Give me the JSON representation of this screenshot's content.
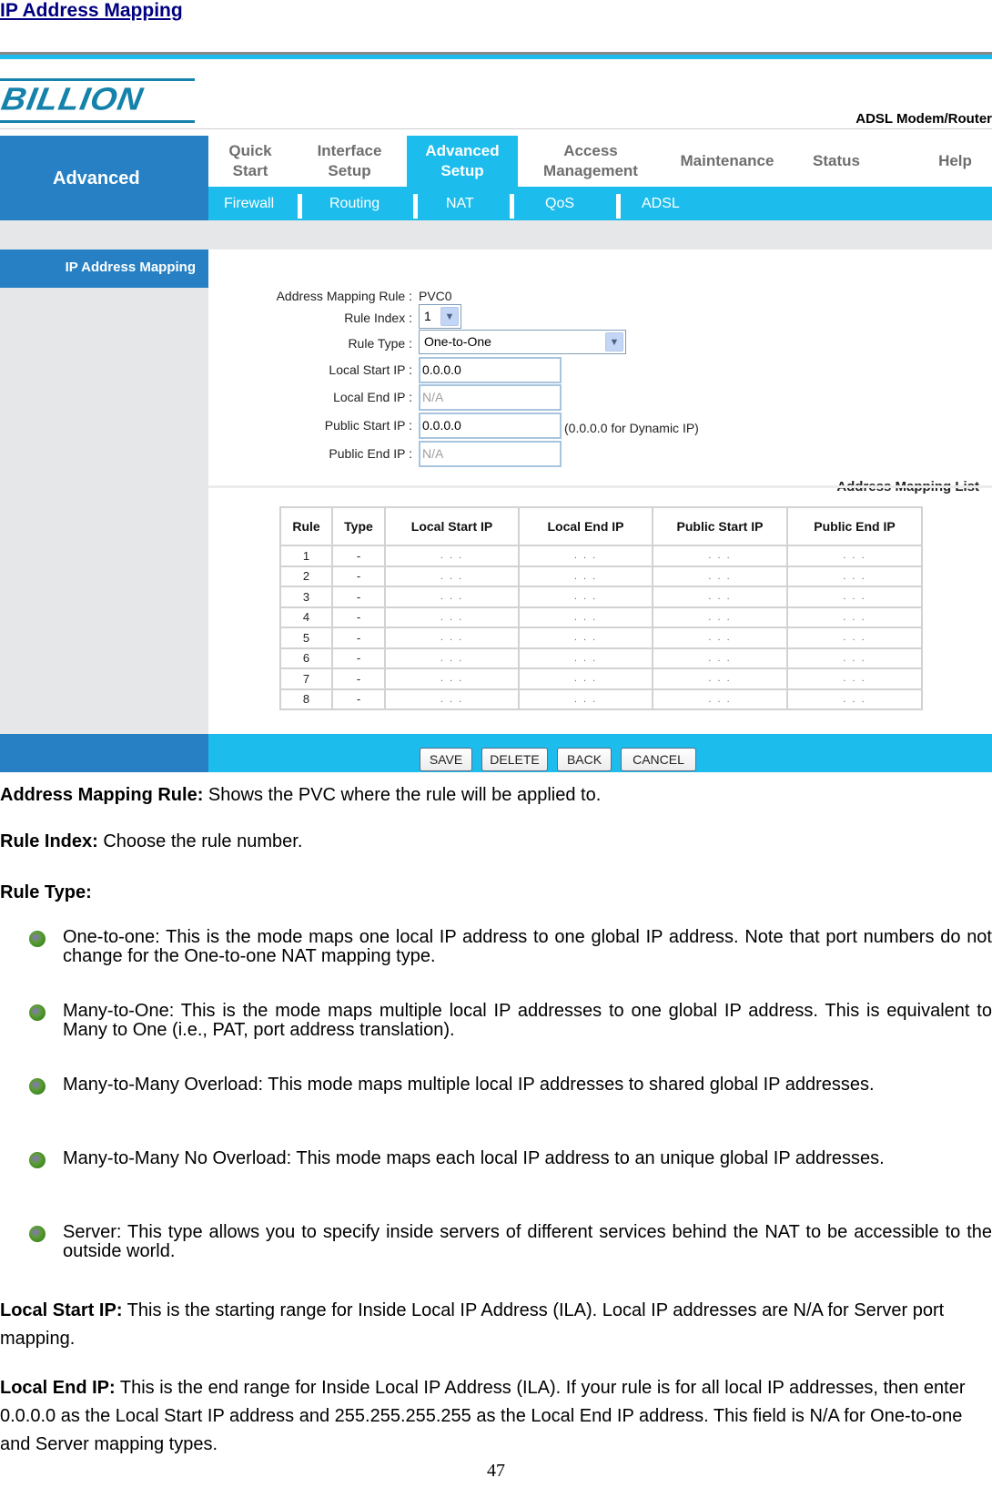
{
  "page_heading": "IP Address Mapping",
  "brand": {
    "logo_text": "BILLION",
    "product": "ADSL Modem/Router"
  },
  "nav": {
    "section": "Advanced",
    "tabs": [
      {
        "label": "Quick\nStart",
        "active": false
      },
      {
        "label": "Interface\nSetup",
        "active": false
      },
      {
        "label": "Advanced\nSetup",
        "active": true
      },
      {
        "label": "Access\nManagement",
        "active": false
      },
      {
        "label": "Maintenance",
        "active": false
      },
      {
        "label": "Status",
        "active": false
      },
      {
        "label": "Help",
        "active": false
      }
    ],
    "subtabs": [
      "Firewall",
      "Routing",
      "NAT",
      "QoS",
      "ADSL"
    ]
  },
  "sidebar": {
    "active": "IP Address Mapping",
    "list_label": "Address Mapping List"
  },
  "form": {
    "address_mapping_rule": {
      "label": "Address Mapping Rule :",
      "value": "PVC0"
    },
    "rule_index": {
      "label": "Rule Index :",
      "value": "1"
    },
    "rule_type": {
      "label": "Rule Type :",
      "value": "One-to-One"
    },
    "local_start_ip": {
      "label": "Local Start IP :",
      "value": "0.0.0.0"
    },
    "local_end_ip": {
      "label": "Local End IP :",
      "value": "N/A"
    },
    "public_start_ip": {
      "label": "Public Start IP :",
      "value": "0.0.0.0",
      "note": "(0.0.0.0 for Dynamic IP)"
    },
    "public_end_ip": {
      "label": "Public End IP :",
      "value": "N/A"
    }
  },
  "mapping_list": {
    "headers": [
      "Rule",
      "Type",
      "Local Start IP",
      "Local End IP",
      "Public Start IP",
      "Public End IP"
    ],
    "rows": [
      [
        "1",
        "-",
        ". . .",
        ". . .",
        ". . .",
        ". . ."
      ],
      [
        "2",
        "-",
        ". . .",
        ". . .",
        ". . .",
        ". . ."
      ],
      [
        "3",
        "-",
        ". . .",
        ". . .",
        ". . .",
        ". . ."
      ],
      [
        "4",
        "-",
        ". . .",
        ". . .",
        ". . .",
        ". . ."
      ],
      [
        "5",
        "-",
        ". . .",
        ". . .",
        ". . .",
        ". . ."
      ],
      [
        "6",
        "-",
        ". . .",
        ". . .",
        ". . .",
        ". . ."
      ],
      [
        "7",
        "-",
        ". . .",
        ". . .",
        ". . .",
        ". . ."
      ],
      [
        "8",
        "-",
        ". . .",
        ". . .",
        ". . .",
        ". . ."
      ]
    ]
  },
  "buttons": {
    "save": "SAVE",
    "delete": "DELETE",
    "back": "BACK",
    "cancel": "CANCEL"
  },
  "descriptions": {
    "address_mapping_rule": {
      "term": "Address Mapping Rule:",
      "text": " Shows the PVC where the rule will be applied to."
    },
    "rule_index": {
      "term": "Rule Index:",
      "text": " Choose the rule number."
    },
    "rule_type": {
      "term": "Rule Type:"
    },
    "rule_types": [
      "One-to-one: This is the mode maps one local IP address to one global IP address. Note that port numbers do not change for the One-to-one NAT mapping type.",
      "Many-to-One: This is the mode maps multiple local IP addresses to one global IP address. This is equivalent to Many to One (i.e., PAT, port address translation).",
      "Many-to-Many Overload: This mode maps multiple local IP addresses to shared global IP addresses.",
      "Many-to-Many No Overload: This mode maps each local IP address to an unique global IP addresses.",
      "Server: This type allows you to specify inside servers of different services behind the NAT to be accessible to the outside world."
    ],
    "local_start_ip": {
      "term": "Local Start IP:",
      "text": " This is the starting range for Inside Local IP Address (ILA). Local IP addresses are N/A for Server port mapping."
    },
    "local_end_ip": {
      "term": "Local End IP:",
      "text": " This is the end range for Inside Local IP Address (ILA). If your rule is for all local IP addresses, then enter 0.0.0.0 as the Local Start IP address and 255.255.255.255 as the Local End IP address. This field is N/A for One-to-one and Server mapping types."
    }
  },
  "page_number": "47"
}
